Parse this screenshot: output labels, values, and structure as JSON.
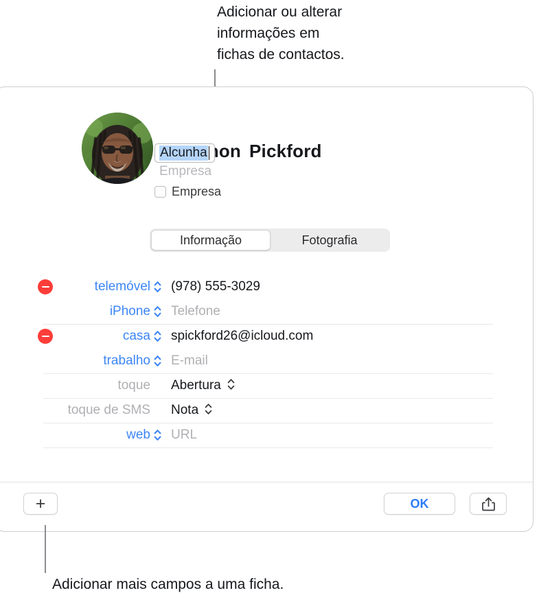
{
  "callouts": {
    "top": "Adicionar ou alterar\ninformações em\nfichas de contactos.",
    "bottom": "Adicionar mais campos a uma ficha."
  },
  "card": {
    "header": {
      "first_name": "Simon",
      "last_name": "Pickford",
      "nickname_value": "Alcunha",
      "company_placeholder": "Empresa",
      "company_checkbox_label": "Empresa",
      "avatar_alt": "contact-photo"
    },
    "segmented_control": {
      "options": [
        {
          "label": "Informação",
          "selected": true
        },
        {
          "label": "Fotografia",
          "selected": false
        }
      ]
    },
    "fields": [
      {
        "has_remove": true,
        "remove_icon": "minus-circle-icon",
        "label": "telemóvel",
        "label_color": "blue",
        "label_stepper": true,
        "value": "(978) 555-3029",
        "is_placeholder": false,
        "value_stepper": false,
        "separator": false
      },
      {
        "has_remove": false,
        "label": "iPhone",
        "label_color": "blue",
        "label_stepper": true,
        "value": "Telefone",
        "is_placeholder": true,
        "value_stepper": false,
        "separator": false
      },
      {
        "has_remove": true,
        "remove_icon": "minus-circle-icon",
        "label": "casa",
        "label_color": "blue",
        "label_stepper": true,
        "value": "spickford26@icloud.com",
        "is_placeholder": false,
        "value_stepper": false,
        "separator": true
      },
      {
        "has_remove": false,
        "label": "trabalho",
        "label_color": "blue",
        "label_stepper": true,
        "value": "E-mail",
        "is_placeholder": true,
        "value_stepper": false,
        "separator": false
      },
      {
        "has_remove": false,
        "label": "toque",
        "label_color": "gray",
        "label_stepper": false,
        "value": "Abertura",
        "is_placeholder": false,
        "value_stepper": true,
        "separator": true
      },
      {
        "has_remove": false,
        "label": "toque de SMS",
        "label_color": "gray",
        "label_stepper": false,
        "value": "Nota",
        "is_placeholder": false,
        "value_stepper": true,
        "separator": true
      },
      {
        "has_remove": false,
        "label": "web",
        "label_color": "blue",
        "label_stepper": true,
        "value": "URL",
        "is_placeholder": true,
        "value_stepper": false,
        "separator": true
      }
    ],
    "toolbar": {
      "add_label": "+",
      "ok_label": "OK",
      "share_icon": "share-icon"
    }
  },
  "colors": {
    "accent_blue": "#3d86f5",
    "ok_blue": "#2b7cf7",
    "remove_red": "#fc3d39",
    "selection_blue": "#b4d5fa",
    "placeholder_gray": "#b0b0b4"
  }
}
